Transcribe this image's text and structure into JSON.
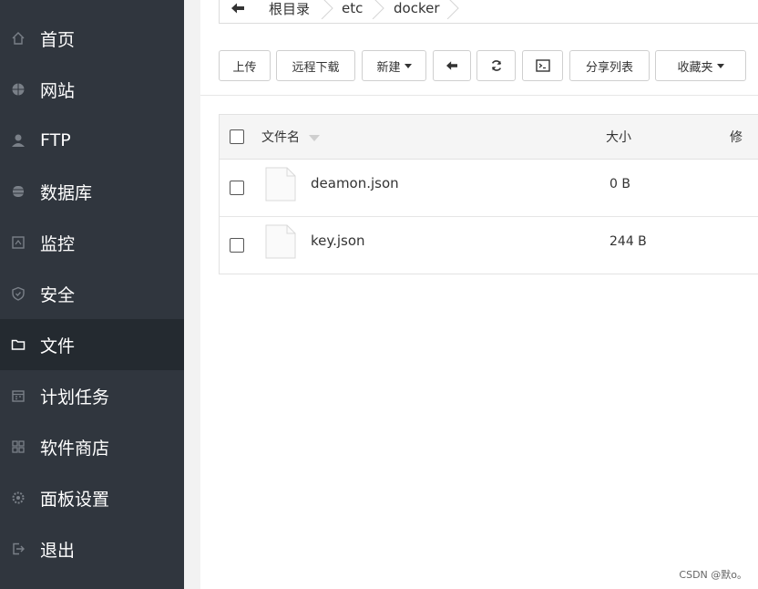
{
  "sidebar": {
    "items": [
      {
        "label": "首页",
        "icon": "home-icon"
      },
      {
        "label": "网站",
        "icon": "globe-icon"
      },
      {
        "label": "FTP",
        "icon": "ftp-user-icon"
      },
      {
        "label": "数据库",
        "icon": "database-icon"
      },
      {
        "label": "监控",
        "icon": "monitor-icon"
      },
      {
        "label": "安全",
        "icon": "shield-icon"
      },
      {
        "label": "文件",
        "icon": "folder-icon",
        "active": true
      },
      {
        "label": "计划任务",
        "icon": "calendar-icon"
      },
      {
        "label": "软件商店",
        "icon": "apps-grid-icon"
      },
      {
        "label": "面板设置",
        "icon": "gear-icon"
      },
      {
        "label": "退出",
        "icon": "logout-icon"
      }
    ]
  },
  "breadcrumb": {
    "items": [
      "根目录",
      "etc",
      "docker"
    ]
  },
  "toolbar": {
    "upload": "上传",
    "remote_download": "远程下载",
    "new": "新建",
    "share_list": "分享列表",
    "favorites": "收藏夹"
  },
  "table": {
    "headers": {
      "name": "文件名",
      "size": "大小",
      "extra": "修"
    },
    "rows": [
      {
        "name": "deamon.json",
        "size": "0 B"
      },
      {
        "name": "key.json",
        "size": "244 B"
      }
    ]
  },
  "watermark": "CSDN @默o。",
  "colors": {
    "sidebar_bg": "#30363e",
    "sidebar_active_bg": "#242a30",
    "content_bg": "#ffffff"
  }
}
